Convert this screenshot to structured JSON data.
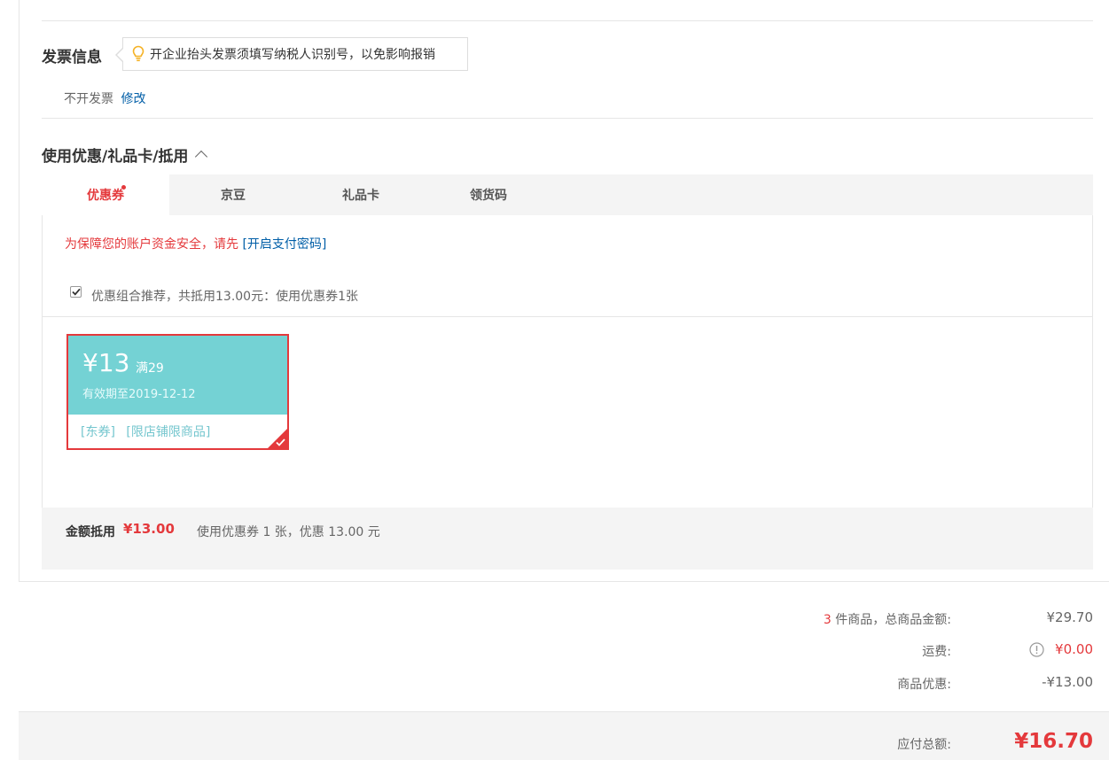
{
  "invoice": {
    "title": "发票信息",
    "tip": "开企业抬头发票须填写纳税人识别号，以免影响报销",
    "status": "不开发票",
    "edit_link": "修改"
  },
  "discount": {
    "title": "使用优惠/礼品卡/抵用",
    "tabs": [
      {
        "label": "优惠券",
        "active": true,
        "dot": true
      },
      {
        "label": "京豆"
      },
      {
        "label": "礼品卡"
      },
      {
        "label": "领货码"
      }
    ],
    "security_notice": "为保障您的账户资金安全，请先",
    "security_link": "[开启支付密码]",
    "combo_checked": true,
    "combo_text": "优惠组合推荐，共抵用13.00元：使用优惠券1张",
    "coupon": {
      "amount": "¥13",
      "condition": "满29",
      "validity": "有效期至2019-12-12",
      "tag1": "[东券]",
      "tag2": "[限店铺限商品]"
    },
    "summary_label": "金额抵用",
    "summary_amount": "¥13.00",
    "summary_text": "使用优惠券 1 张，优惠 13.00 元"
  },
  "totals": {
    "item_count": "3",
    "items_label": " 件商品，总商品金额:",
    "items_amount": "¥29.70",
    "shipping_label": "运费:",
    "shipping_amount": "¥0.00",
    "discount_label": "商品优惠:",
    "discount_amount": "-¥13.00",
    "payable_label": "应付总额:",
    "payable_amount": "¥16.70"
  },
  "colors": {
    "accent_red": "#e4393c",
    "link_blue": "#005ea7",
    "coupon_teal": "#74d2d4",
    "shipping_orange": "#e4393c"
  }
}
